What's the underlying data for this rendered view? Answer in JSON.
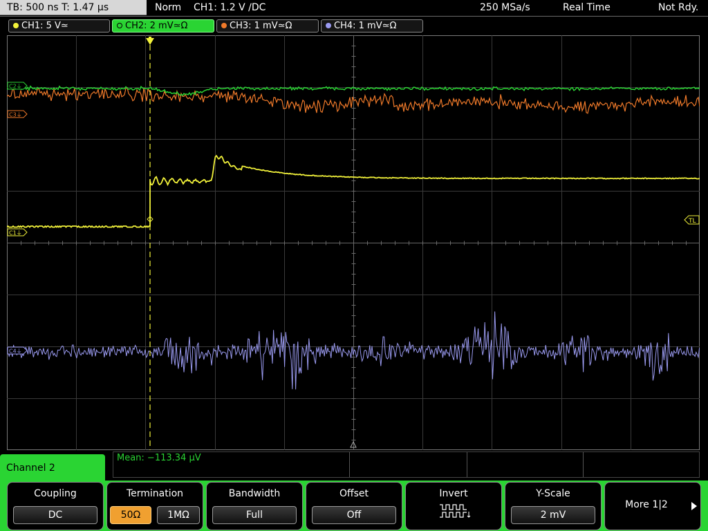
{
  "status_bar": {
    "timebase": "TB: 500 ns   T: 1.47 µs",
    "trigger_mode": "Norm",
    "trigger_info": "CH1: 1.2 V ∕DC",
    "sample_rate": "250 MSa/s",
    "acq_mode": "Real Time",
    "state": "Not Rdy."
  },
  "channels": [
    {
      "label": "CH1: 5 V≃",
      "color": "#f2f23a"
    },
    {
      "label": "CH2: 2 mV≃Ω",
      "color": "#2ad433",
      "active": true
    },
    {
      "label": "CH3: 1 mV≃Ω",
      "color": "#f07a2a"
    },
    {
      "label": "CH4: 1 mV≃Ω",
      "color": "#9a9af0"
    }
  ],
  "markers": {
    "c1": "C1⏚",
    "c2": "C2⏚",
    "c3": "C3⏚",
    "c4": "C4⏚",
    "tl": "TL"
  },
  "panel": {
    "title": "Channel 2"
  },
  "measurement": {
    "mean": "Mean: −113.34 µV"
  },
  "softkeys": {
    "coupling": {
      "title": "Coupling",
      "value": "DC"
    },
    "termination": {
      "title": "Termination",
      "opt1": "50Ω",
      "opt2": "1MΩ"
    },
    "bandwidth": {
      "title": "Bandwidth",
      "value": "Full"
    },
    "offset": {
      "title": "Offset",
      "value": "Off"
    },
    "invert": {
      "title": "Invert"
    },
    "yscale": {
      "title": "Y-Scale",
      "value": "2 mV"
    },
    "more": {
      "label": "More 1|2"
    }
  }
}
